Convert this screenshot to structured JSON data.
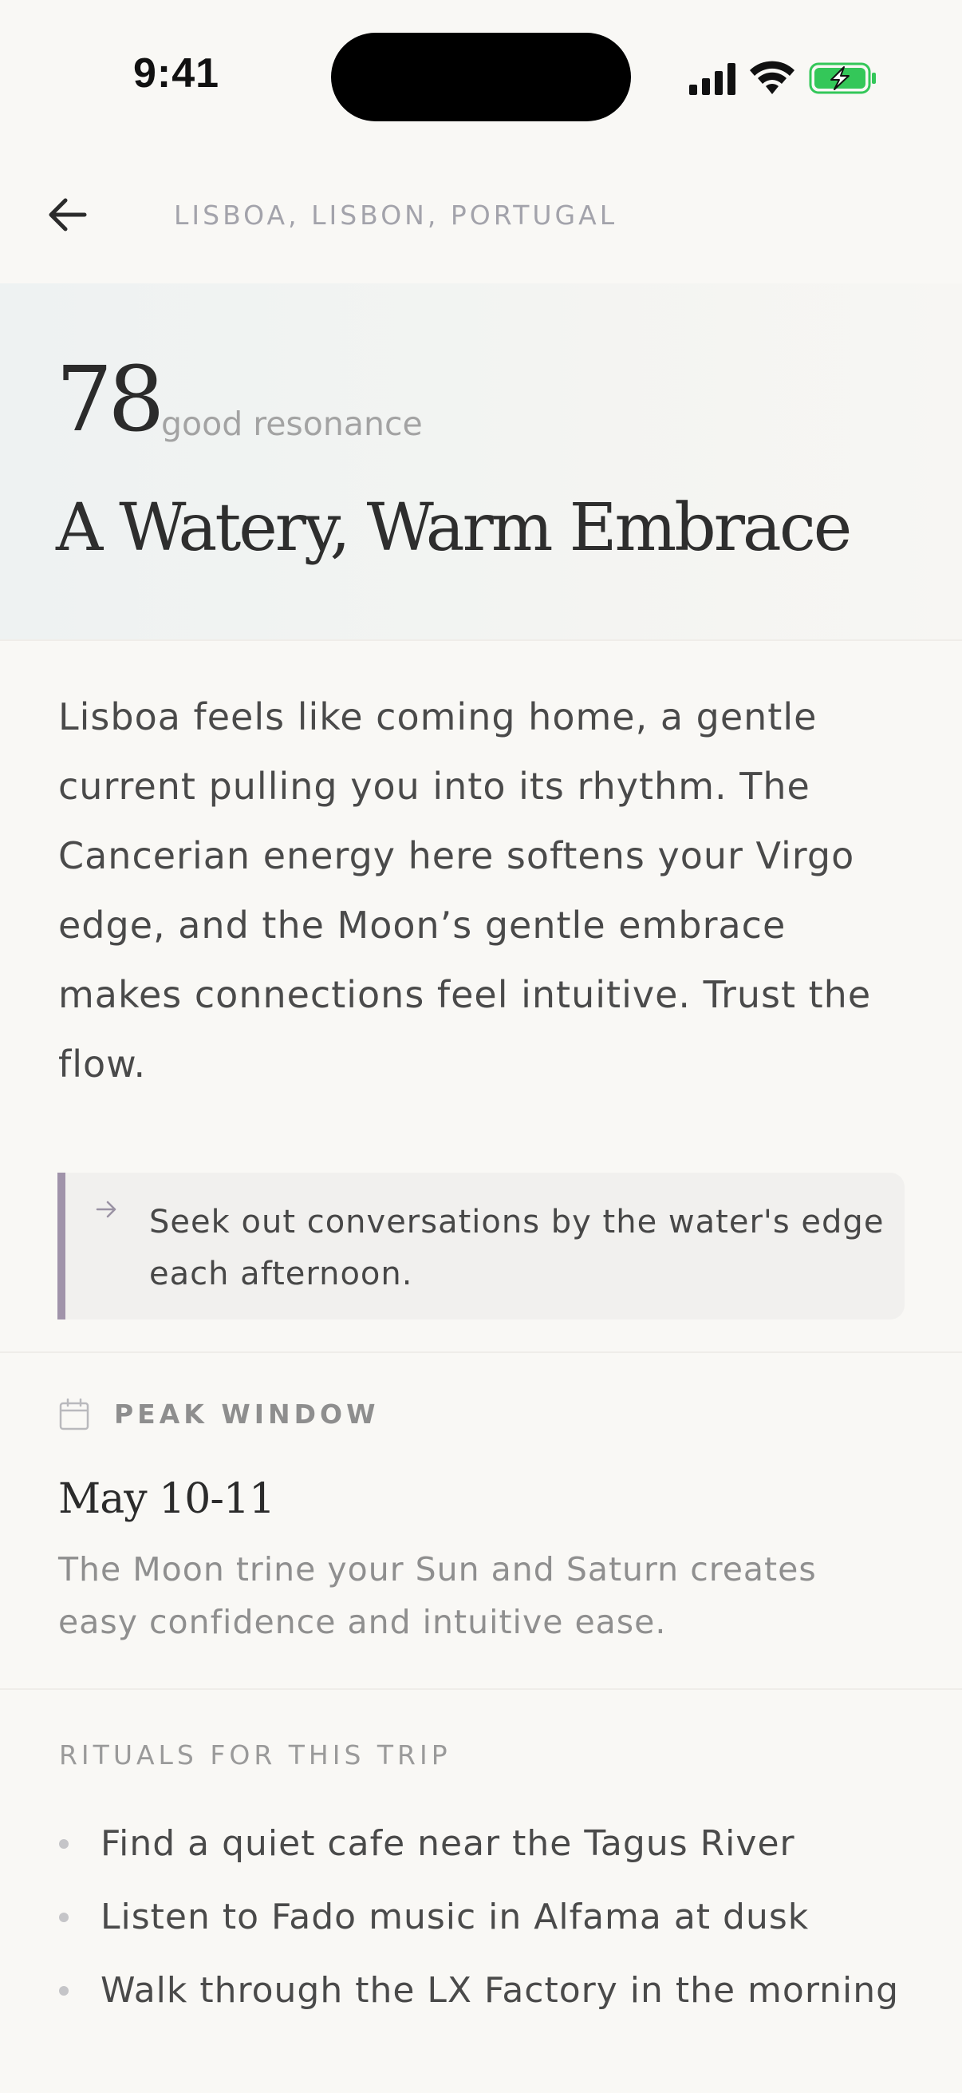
{
  "status_bar": {
    "time": "9:41",
    "battery_color": "#34c759",
    "icons": [
      "signal-icon",
      "wifi-icon",
      "battery-charging-icon"
    ]
  },
  "nav": {
    "back_icon": "arrow-left-icon",
    "location": "LISBOA, LISBON, PORTUGAL"
  },
  "hero": {
    "score": "78",
    "score_label": "good resonance",
    "title": "A Watery, Warm Embrace",
    "gradient_colors": [
      "#eef2f2",
      "#f7f6f3"
    ]
  },
  "description": "Lisboa feels like coming home, a gentle current pulling you into its rhythm. The Cancerian energy here softens your Virgo edge, and the Moon’s gentle embrace makes connections feel intuitive. Trust the flow.",
  "tip": {
    "icon": "arrow-right-icon",
    "text": "Seek out conversations by the water's edge each afternoon.",
    "accent_color": "#a093aa"
  },
  "peak_window": {
    "icon": "calendar-icon",
    "label": "PEAK WINDOW",
    "date": "May 10-11",
    "description": "The Moon trine your Sun and Saturn creates easy confidence and intuitive ease."
  },
  "rituals": {
    "heading": "RITUALS FOR THIS TRIP",
    "items": [
      {
        "text": "Find a quiet cafe near the Tagus River"
      },
      {
        "text": "Listen to Fado music in Alfama at dusk"
      },
      {
        "text": "Walk through the LX Factory in the morning"
      }
    ]
  }
}
